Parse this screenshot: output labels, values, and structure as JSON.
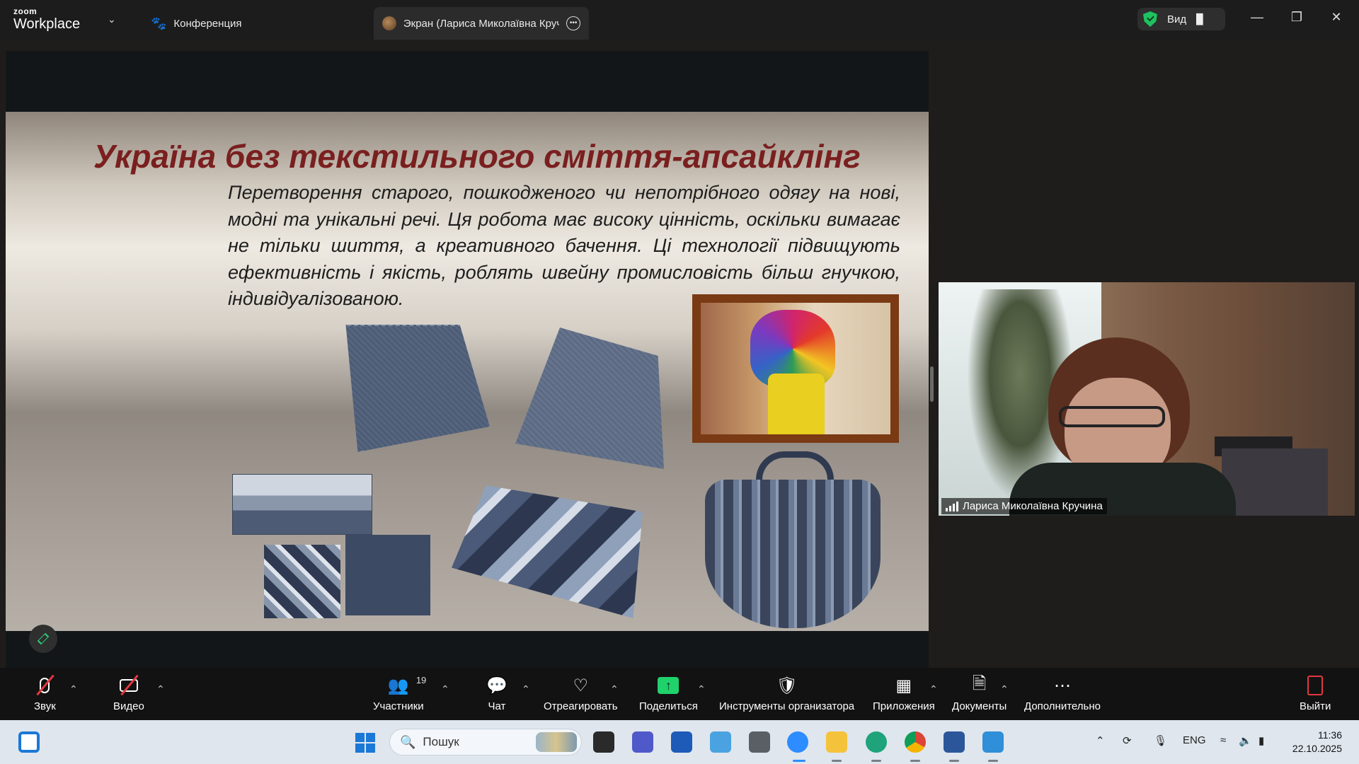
{
  "app": {
    "brand_small": "zoom",
    "brand_big": "Workplace",
    "tab_meeting": "Конференция",
    "tab_screen": "Экран (Лариса Миколаївна Кручина)",
    "view_label": "Вид"
  },
  "slide": {
    "title": "Україна без текстильного сміття-апсайклінг",
    "body": "Перетворення старого, пошкодженого чи непотрібного одягу на нові, модні та унікальні речі. Ця робота має високу цінність, оскільки вимагає не тільки шиття, а креативного бачення.    Ці технології підвищують ефективність і якість, роблять швейну промисловість більш гнучкою, індивідуалізованою."
  },
  "participant": {
    "name": "Лариса Миколаївна Кручина"
  },
  "toolbar": {
    "audio": "Звук",
    "video": "Видео",
    "participants": "Участники",
    "participants_count": "19",
    "chat": "Чат",
    "react": "Отреагировать",
    "share": "Поделиться",
    "host_tools": "Инструменты организатора",
    "apps": "Приложения",
    "docs": "Документы",
    "more": "Дополнительно",
    "leave": "Выйти"
  },
  "taskbar": {
    "search_placeholder": "Пошук",
    "lang": "ENG",
    "time": "11:36",
    "date": "22.10.2025"
  },
  "colors": {
    "title_red": "#7a1f1f",
    "share_green": "#1fd26b",
    "leave_red": "#e2383f",
    "shield_green": "#1ec25f"
  }
}
